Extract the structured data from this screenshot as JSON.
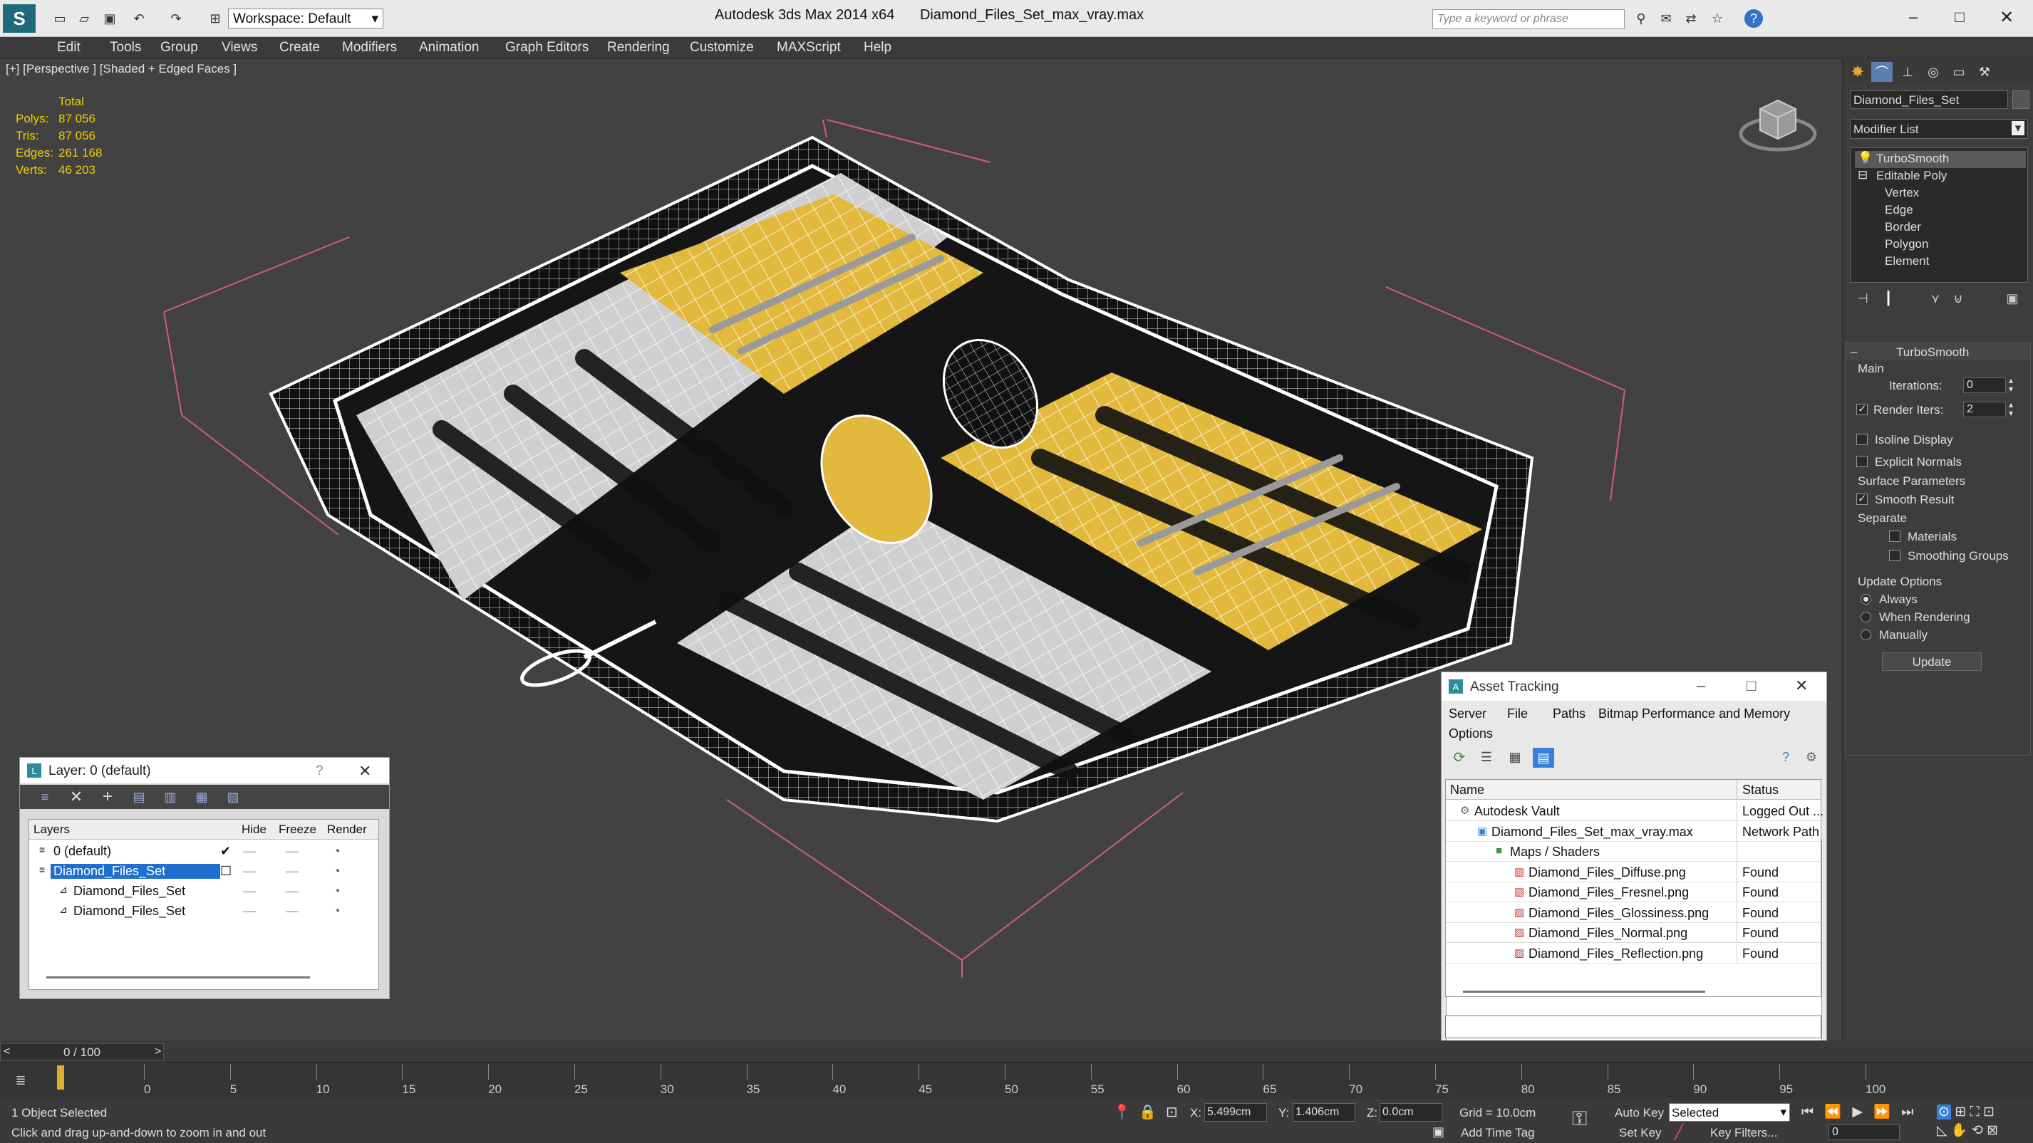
{
  "app": {
    "title": "Autodesk 3ds Max  2014 x64",
    "file": "Diamond_Files_Set_max_vray.max",
    "workspace": "Workspace: Default",
    "search_placeholder": "Type a keyword or phrase"
  },
  "menu": [
    "Edit",
    "Tools",
    "Group",
    "Views",
    "Create",
    "Modifiers",
    "Animation",
    "Graph Editors",
    "Rendering",
    "Customize",
    "MAXScript",
    "Help"
  ],
  "viewport": {
    "label": "[+] [Perspective ] [Shaded + Edged Faces ]",
    "stats": {
      "header": "Total",
      "rows": [
        {
          "k": "Polys:",
          "v": "87 056"
        },
        {
          "k": "Tris:",
          "v": "87 056"
        },
        {
          "k": "Edges:",
          "v": "261 168"
        },
        {
          "k": "Verts:",
          "v": "46 203"
        }
      ]
    }
  },
  "layer_panel": {
    "title": "Layer: 0 (default)",
    "help": "?",
    "cols": {
      "layers": "Layers",
      "hide": "Hide",
      "freeze": "Freeze",
      "render": "Render"
    },
    "rows": [
      {
        "name": "0 (default)",
        "selected": false
      },
      {
        "name": "Diamond_Files_Set",
        "selected": true
      },
      {
        "name": "Diamond_Files_Set",
        "selected": false
      },
      {
        "name": "Diamond_Files_Set",
        "selected": false
      }
    ]
  },
  "asset_panel": {
    "title": "Asset Tracking",
    "menu1": [
      "Server",
      "File",
      "Paths",
      "Bitmap Performance and Memory"
    ],
    "menu2": "Options",
    "cols": {
      "name": "Name",
      "status": "Status"
    },
    "rows": [
      {
        "name": "Autodesk Vault",
        "status": "Logged Out ..."
      },
      {
        "name": "Diamond_Files_Set_max_vray.max",
        "status": "Network Path"
      },
      {
        "name": "Maps / Shaders",
        "status": ""
      },
      {
        "name": "Diamond_Files_Diffuse.png",
        "status": "Found"
      },
      {
        "name": "Diamond_Files_Fresnel.png",
        "status": "Found"
      },
      {
        "name": "Diamond_Files_Glossiness.png",
        "status": "Found"
      },
      {
        "name": "Diamond_Files_Normal.png",
        "status": "Found"
      },
      {
        "name": "Diamond_Files_Reflection.png",
        "status": "Found"
      }
    ]
  },
  "cmd": {
    "object_name": "Diamond_Files_Set",
    "modifier_list": "Modifier List",
    "stack": [
      "TurboSmooth",
      "Editable Poly",
      "Vertex",
      "Edge",
      "Border",
      "Polygon",
      "Element"
    ],
    "rollout_title": "TurboSmooth",
    "main_label": "Main",
    "iterations_label": "Iterations:",
    "iterations": "0",
    "render_iters_label": "Render Iters:",
    "render_iters": "2",
    "isoline": "Isoline Display",
    "explicit": "Explicit Normals",
    "surface_params": "Surface Parameters",
    "smooth_result": "Smooth Result",
    "separate": "Separate",
    "materials": "Materials",
    "smoothing_groups": "Smoothing Groups",
    "update_options": "Update Options",
    "always": "Always",
    "when_rendering": "When Rendering",
    "manually": "Manually",
    "update_btn": "Update"
  },
  "timeline": {
    "frame": "0 / 100",
    "ticks": [
      "0",
      "5",
      "10",
      "15",
      "20",
      "25",
      "30",
      "35",
      "40",
      "45",
      "50",
      "55",
      "60",
      "65",
      "70",
      "75",
      "80",
      "85",
      "90",
      "95",
      "100"
    ]
  },
  "status": {
    "selected": "1 Object Selected",
    "prompt": "Click and drag up-and-down to zoom in and out",
    "x_label": "X:",
    "x": "5.499cm",
    "y_label": "Y:",
    "y": "1.406cm",
    "z_label": "Z:",
    "z": "0.0cm",
    "grid": "Grid = 10.0cm",
    "add_time_tag": "Add Time Tag",
    "auto_key": "Auto Key",
    "set_key": "Set Key",
    "selected_dd": "Selected",
    "key_filters": "Key Filters...",
    "frame_field": "0"
  },
  "colors": {
    "accent": "#f0c030",
    "selection": "#1e6fd0",
    "stats": "#f0d000"
  }
}
